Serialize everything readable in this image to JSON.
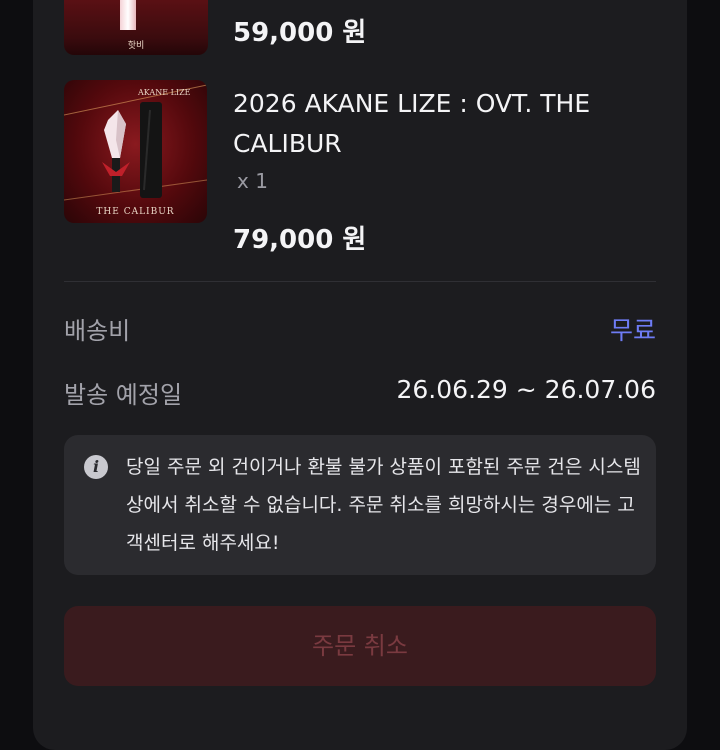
{
  "items": [
    {
      "thumb_caption": "핫비",
      "price": "59,000 원"
    },
    {
      "thumb_text_top": "AKANE LIZE",
      "thumb_caption": "THE CALIBUR",
      "title": "2026 AKANE LIZE : OVT. THE CALIBUR",
      "quantity": "x 1",
      "price": "79,000 원"
    }
  ],
  "shipping": {
    "fee_label": "배송비",
    "fee_value": "무료",
    "date_label": "발송 예정일",
    "date_value": "26.06.29 ~ 26.07.06"
  },
  "notice": {
    "icon": "info-icon",
    "text": "당일 주문 외 건이거나 환불 불가 상품이 포함된 주문 건은 시스템 상에서 취소할 수 없습니다. 주문 취소를 희망하시는 경우에는 고객센터로 해주세요!"
  },
  "actions": {
    "cancel_label": "주문 취소"
  },
  "colors": {
    "accent": "#6e7cf5",
    "card_bg": "#1c1c1f",
    "cancel_bg": "#3a1b1e",
    "cancel_text": "#7a3a40"
  }
}
